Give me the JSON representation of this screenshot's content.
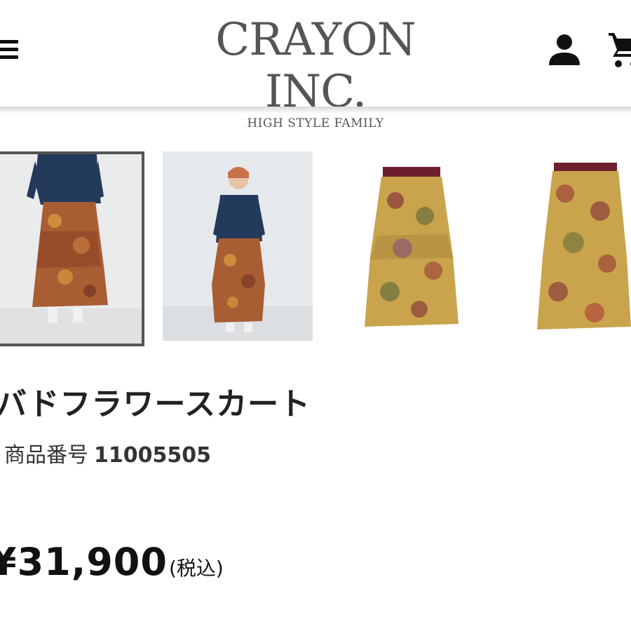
{
  "header": {
    "logo_main": "CRAYON INC.",
    "logo_sub": "HIGH STYLE FAMILY",
    "menu_icon": "hamburger-menu-icon",
    "user_icon": "user-account-icon",
    "cart_icon": "shopping-cart-icon"
  },
  "gallery": {
    "images": [
      {
        "name": "model-front-photo",
        "selected": true
      },
      {
        "name": "model-full-photo",
        "selected": false
      },
      {
        "name": "skirt-front-photo",
        "selected": false
      },
      {
        "name": "skirt-back-photo",
        "selected": false
      }
    ]
  },
  "product": {
    "title": "バドフラワースカート",
    "number_label": "商品番号",
    "number_value": "11005505",
    "price": "¥31,900",
    "tax_note": "(税込)"
  },
  "colors": {
    "text": "#222222",
    "logo": "#555555",
    "selected_border": "#555555"
  }
}
